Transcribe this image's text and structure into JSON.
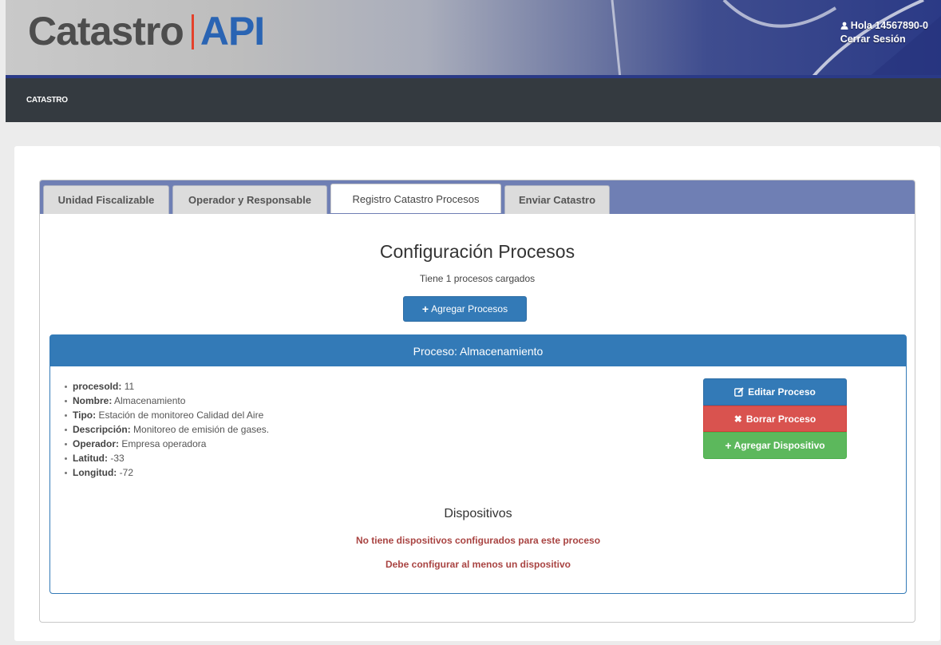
{
  "header": {
    "brand_left": "Catastro",
    "brand_right": "API",
    "greeting": "Hola 14567890-0",
    "logout": "Cerrar Sesión",
    "colors": {
      "brand_right": "#2a64b3",
      "separator": "#e4412b",
      "accent": "#2a3a87"
    }
  },
  "nav": {
    "item": "CATASTRO"
  },
  "tabs": [
    {
      "label": "Unidad Fiscalizable"
    },
    {
      "label": "Operador y Responsable"
    },
    {
      "label": "Registro Catastro Procesos"
    },
    {
      "label": "Enviar Catastro"
    }
  ],
  "active_tab": "Registro Catastro Procesos",
  "config": {
    "title": "Configuración Procesos",
    "subtitle": "Tiene 1 procesos cargados",
    "add_button": "Agregar Procesos"
  },
  "process": {
    "heading": "Proceso: Almacenamiento",
    "fields": [
      {
        "label": "procesoId:",
        "value": "11"
      },
      {
        "label": "Nombre:",
        "value": "Almacenamiento"
      },
      {
        "label": "Tipo:",
        "value": "Estación de monitoreo Calidad del Aire"
      },
      {
        "label": "Descripción:",
        "value": "Monitoreo de emisión de gases."
      },
      {
        "label": "Operador:",
        "value": "Empresa operadora"
      },
      {
        "label": "Latitud:",
        "value": "-33"
      },
      {
        "label": "Longitud:",
        "value": "-72"
      }
    ],
    "buttons": {
      "edit": "Editar Proceso",
      "delete": "Borrar Proceso",
      "add_device": "Agregar Dispositivo"
    }
  },
  "devices": {
    "title": "Dispositivos",
    "warning_1": "No tiene dispositivos configurados para este proceso",
    "warning_2": "Debe configurar al menos un dispositivo"
  }
}
